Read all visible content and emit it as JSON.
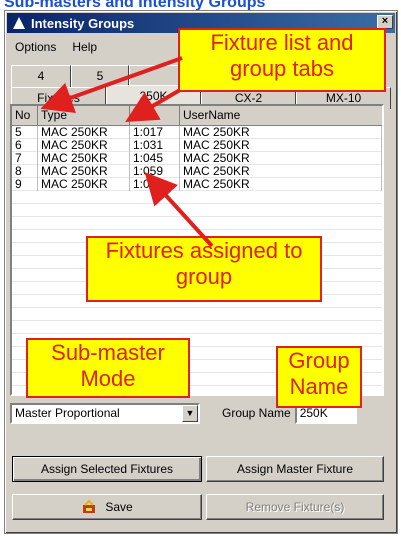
{
  "page_heading": "Sub-masters and Intensity Groups",
  "window": {
    "title": "Intensity Groups",
    "close_glyph": "×"
  },
  "menu": [
    {
      "label": "Options"
    },
    {
      "label": "Help"
    }
  ],
  "tabs": {
    "back_row": [
      "4",
      "5",
      "",
      ""
    ],
    "front_row": [
      "Fixtures",
      "250K",
      "CX-2",
      "MX-10"
    ],
    "active": "250K"
  },
  "list": {
    "columns": [
      "No",
      "Type",
      "Adr",
      "UserName"
    ],
    "rows": [
      {
        "no": "5",
        "type": "MAC 250KR",
        "adr": "1:017",
        "user": "MAC 250KR"
      },
      {
        "no": "6",
        "type": "MAC 250KR",
        "adr": "1:031",
        "user": "MAC 250KR"
      },
      {
        "no": "7",
        "type": "MAC 250KR",
        "adr": "1:045",
        "user": "MAC 250KR"
      },
      {
        "no": "8",
        "type": "MAC 250KR",
        "adr": "1:059",
        "user": "MAC 250KR"
      },
      {
        "no": "9",
        "type": "MAC 250KR",
        "adr": "1:073",
        "user": "MAC 250KR"
      }
    ]
  },
  "controls": {
    "mode_value": "Master Proportional",
    "group_name_label": "Group Name",
    "group_name_value": "250K"
  },
  "buttons": {
    "assign_selected": "Assign Selected Fixtures",
    "assign_master": "Assign Master Fixture",
    "save": "Save",
    "remove": "Remove Fixture(s)"
  },
  "callouts": {
    "tabs": "Fixture list and group tabs",
    "assigned": "Fixtures assigned to group",
    "mode": "Sub-master Mode",
    "group_name": "Group Name"
  },
  "colors": {
    "callout_fill": "#ffff00",
    "callout_text": "#e0201e",
    "titlebar": "#0a246a",
    "heading": "#1a4fd8"
  },
  "icons": [
    "app-icon",
    "close-icon",
    "dropdown-arrow-icon",
    "save-icon"
  ]
}
